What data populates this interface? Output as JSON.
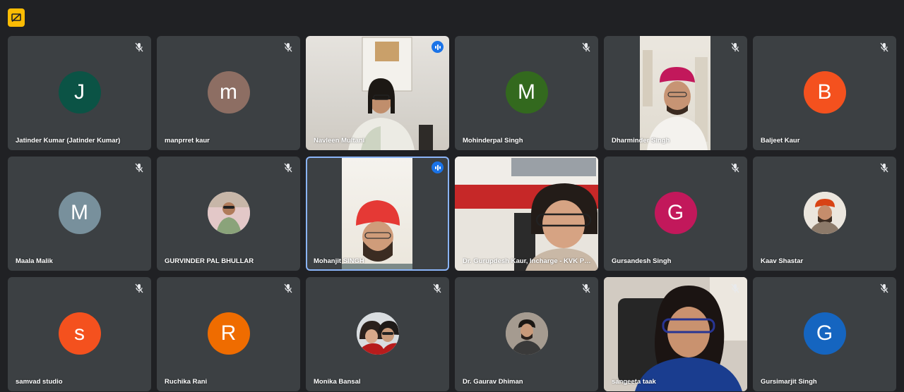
{
  "toolbar": {
    "icon": "no-present-icon"
  },
  "colors": {
    "tile": "#3c4043",
    "background": "#202124",
    "accent": "#8ab4f8"
  },
  "participants": [
    {
      "name": "Jatinder Kumar (Jatinder Kumar)",
      "initial": "J",
      "avatar_color": "#0b5345",
      "muted": true
    },
    {
      "name": "manprret kaur",
      "initial": "m",
      "avatar_color": "#8d6e63",
      "muted": true
    },
    {
      "name": "Navleen Multani",
      "video": true,
      "speaking": true
    },
    {
      "name": "Mohinderpal Singh",
      "initial": "M",
      "avatar_color": "#33691e",
      "muted": true
    },
    {
      "name": "Dharminder Singh",
      "video": true,
      "muted": true
    },
    {
      "name": "Baljeet Kaur",
      "initial": "B",
      "avatar_color": "#f4511e",
      "muted": true
    },
    {
      "name": "Maala Malik",
      "initial": "M",
      "avatar_color": "#78909c",
      "muted": true
    },
    {
      "name": "GURVINDER PAL BHULLAR",
      "photo": true,
      "muted": true
    },
    {
      "name": "Mohanjit SINGH",
      "video": true,
      "speaking": true,
      "active": true
    },
    {
      "name": "Dr. Gurupdesh Kaur, Incharge - KVK Pa...",
      "video": true
    },
    {
      "name": "Gursandesh Singh",
      "initial": "G",
      "avatar_color": "#c2185b",
      "muted": true
    },
    {
      "name": "Kaav Shastar",
      "photo": true,
      "muted": true
    },
    {
      "name": "samvad studio",
      "initial": "s",
      "avatar_color": "#f4511e",
      "muted": true
    },
    {
      "name": "Ruchika Rani",
      "initial": "R",
      "avatar_color": "#ef6c00",
      "muted": true
    },
    {
      "name": "Monika Bansal",
      "photo": true,
      "muted": true
    },
    {
      "name": "Dr. Gaurav Dhiman",
      "photo": true,
      "muted": true
    },
    {
      "name": "sangeeta taak",
      "video": true,
      "muted": true
    },
    {
      "name": "Gursimarjit Singh",
      "initial": "G",
      "avatar_color": "#1565c0",
      "muted": true
    }
  ]
}
